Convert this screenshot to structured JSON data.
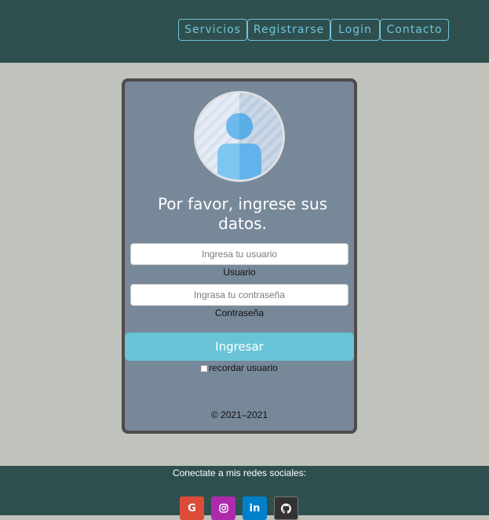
{
  "nav": {
    "items": [
      {
        "label": "Servicios"
      },
      {
        "label": "Registrarse"
      },
      {
        "label": "Login"
      },
      {
        "label": "Contacto"
      }
    ]
  },
  "login": {
    "avatar_icon": "user-avatar-icon",
    "title": "Por favor, ingrese sus datos.",
    "username": {
      "placeholder": "Ingresa tu usuario",
      "value": "",
      "label": "Usuario"
    },
    "password": {
      "placeholder": "Ingrasa tu contraseña",
      "value": "",
      "label": "Contraseña"
    },
    "submit_label": "Ingresar",
    "remember_label": "recordar usuario",
    "remember_checked": false,
    "copyright": "© 2021–2021"
  },
  "footer": {
    "text": "Conectate a mis redes sociales:",
    "socials": [
      {
        "icon": "google-icon",
        "glyph": "G",
        "color": "#dd4b39"
      },
      {
        "icon": "instagram-icon",
        "glyph": "◎",
        "color": "#ac2bac"
      },
      {
        "icon": "linkedin-icon",
        "glyph": "in",
        "color": "#0082ca"
      },
      {
        "icon": "github-icon",
        "glyph": "●",
        "color": "#333333"
      }
    ]
  },
  "colors": {
    "header_bg": "#2f4f4f",
    "page_bg": "#c0c3bb",
    "card_bg": "#778899",
    "accent": "#6ac4d8"
  }
}
